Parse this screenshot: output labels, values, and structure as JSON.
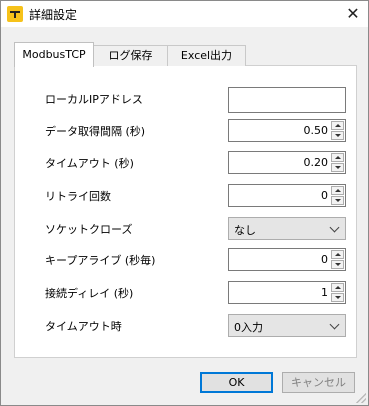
{
  "window": {
    "title": "詳細設定",
    "app_icon": "yellow-app-icon",
    "close_label": "✕"
  },
  "tabs": [
    {
      "label": "ModbusTCP",
      "active": true
    },
    {
      "label": "ログ保存",
      "active": false
    },
    {
      "label": "Excel出力",
      "active": false
    }
  ],
  "fields": {
    "local_ip": {
      "label": "ローカルIPアドレス",
      "value": ""
    },
    "interval": {
      "label": "データ取得間隔 (秒)",
      "value": "0.50"
    },
    "timeout": {
      "label": "タイムアウト (秒)",
      "value": "0.20"
    },
    "retry": {
      "label": "リトライ回数",
      "value": "0"
    },
    "socket_close": {
      "label": "ソケットクローズ",
      "value": "なし"
    },
    "keepalive": {
      "label": "キープアライブ (秒毎)",
      "value": "0"
    },
    "reconnect_delay": {
      "label": "接続ディレイ (秒)",
      "value": "1"
    },
    "on_timeout": {
      "label": "タイムアウト時",
      "value": "0入力"
    }
  },
  "buttons": {
    "ok": "OK",
    "cancel": "キャンセル"
  }
}
